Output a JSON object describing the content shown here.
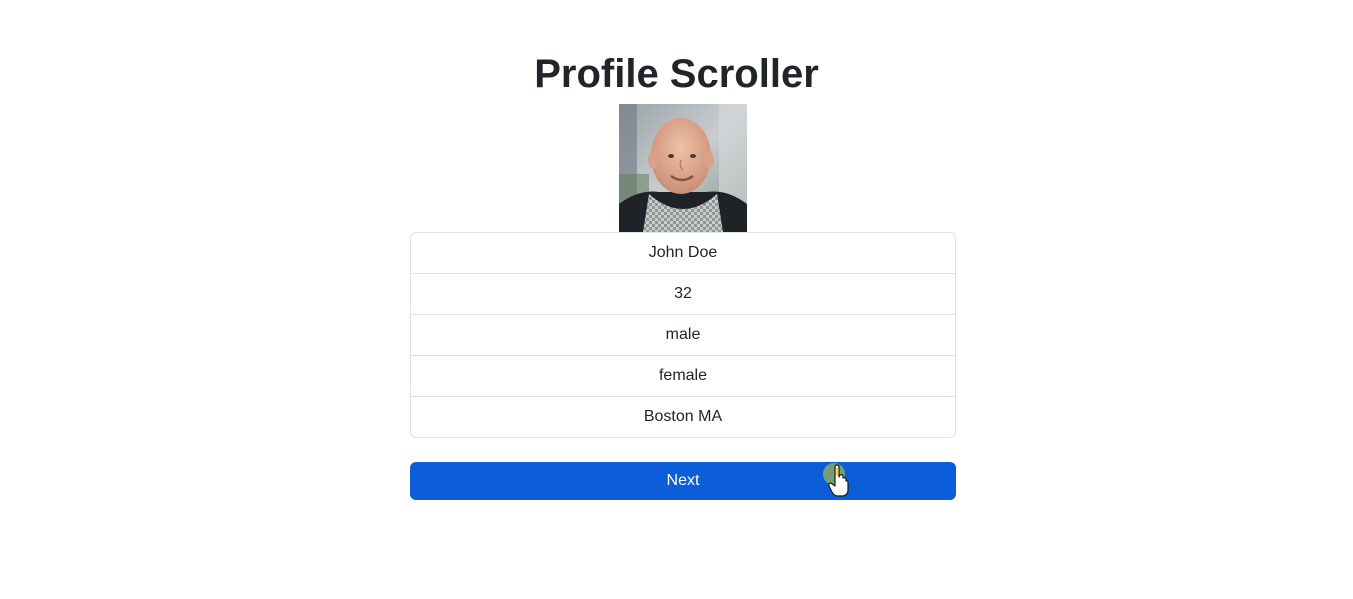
{
  "header": {
    "title": "Profile Scroller"
  },
  "profile": {
    "fields": [
      "John Doe",
      "32",
      "male",
      "female",
      "Boston MA"
    ]
  },
  "actions": {
    "next_label": "Next"
  },
  "colors": {
    "primary_button": "#0b5ed7",
    "text": "#212529",
    "border": "#dee2e6"
  },
  "icons": {
    "cursor": "hand-pointer-icon"
  }
}
